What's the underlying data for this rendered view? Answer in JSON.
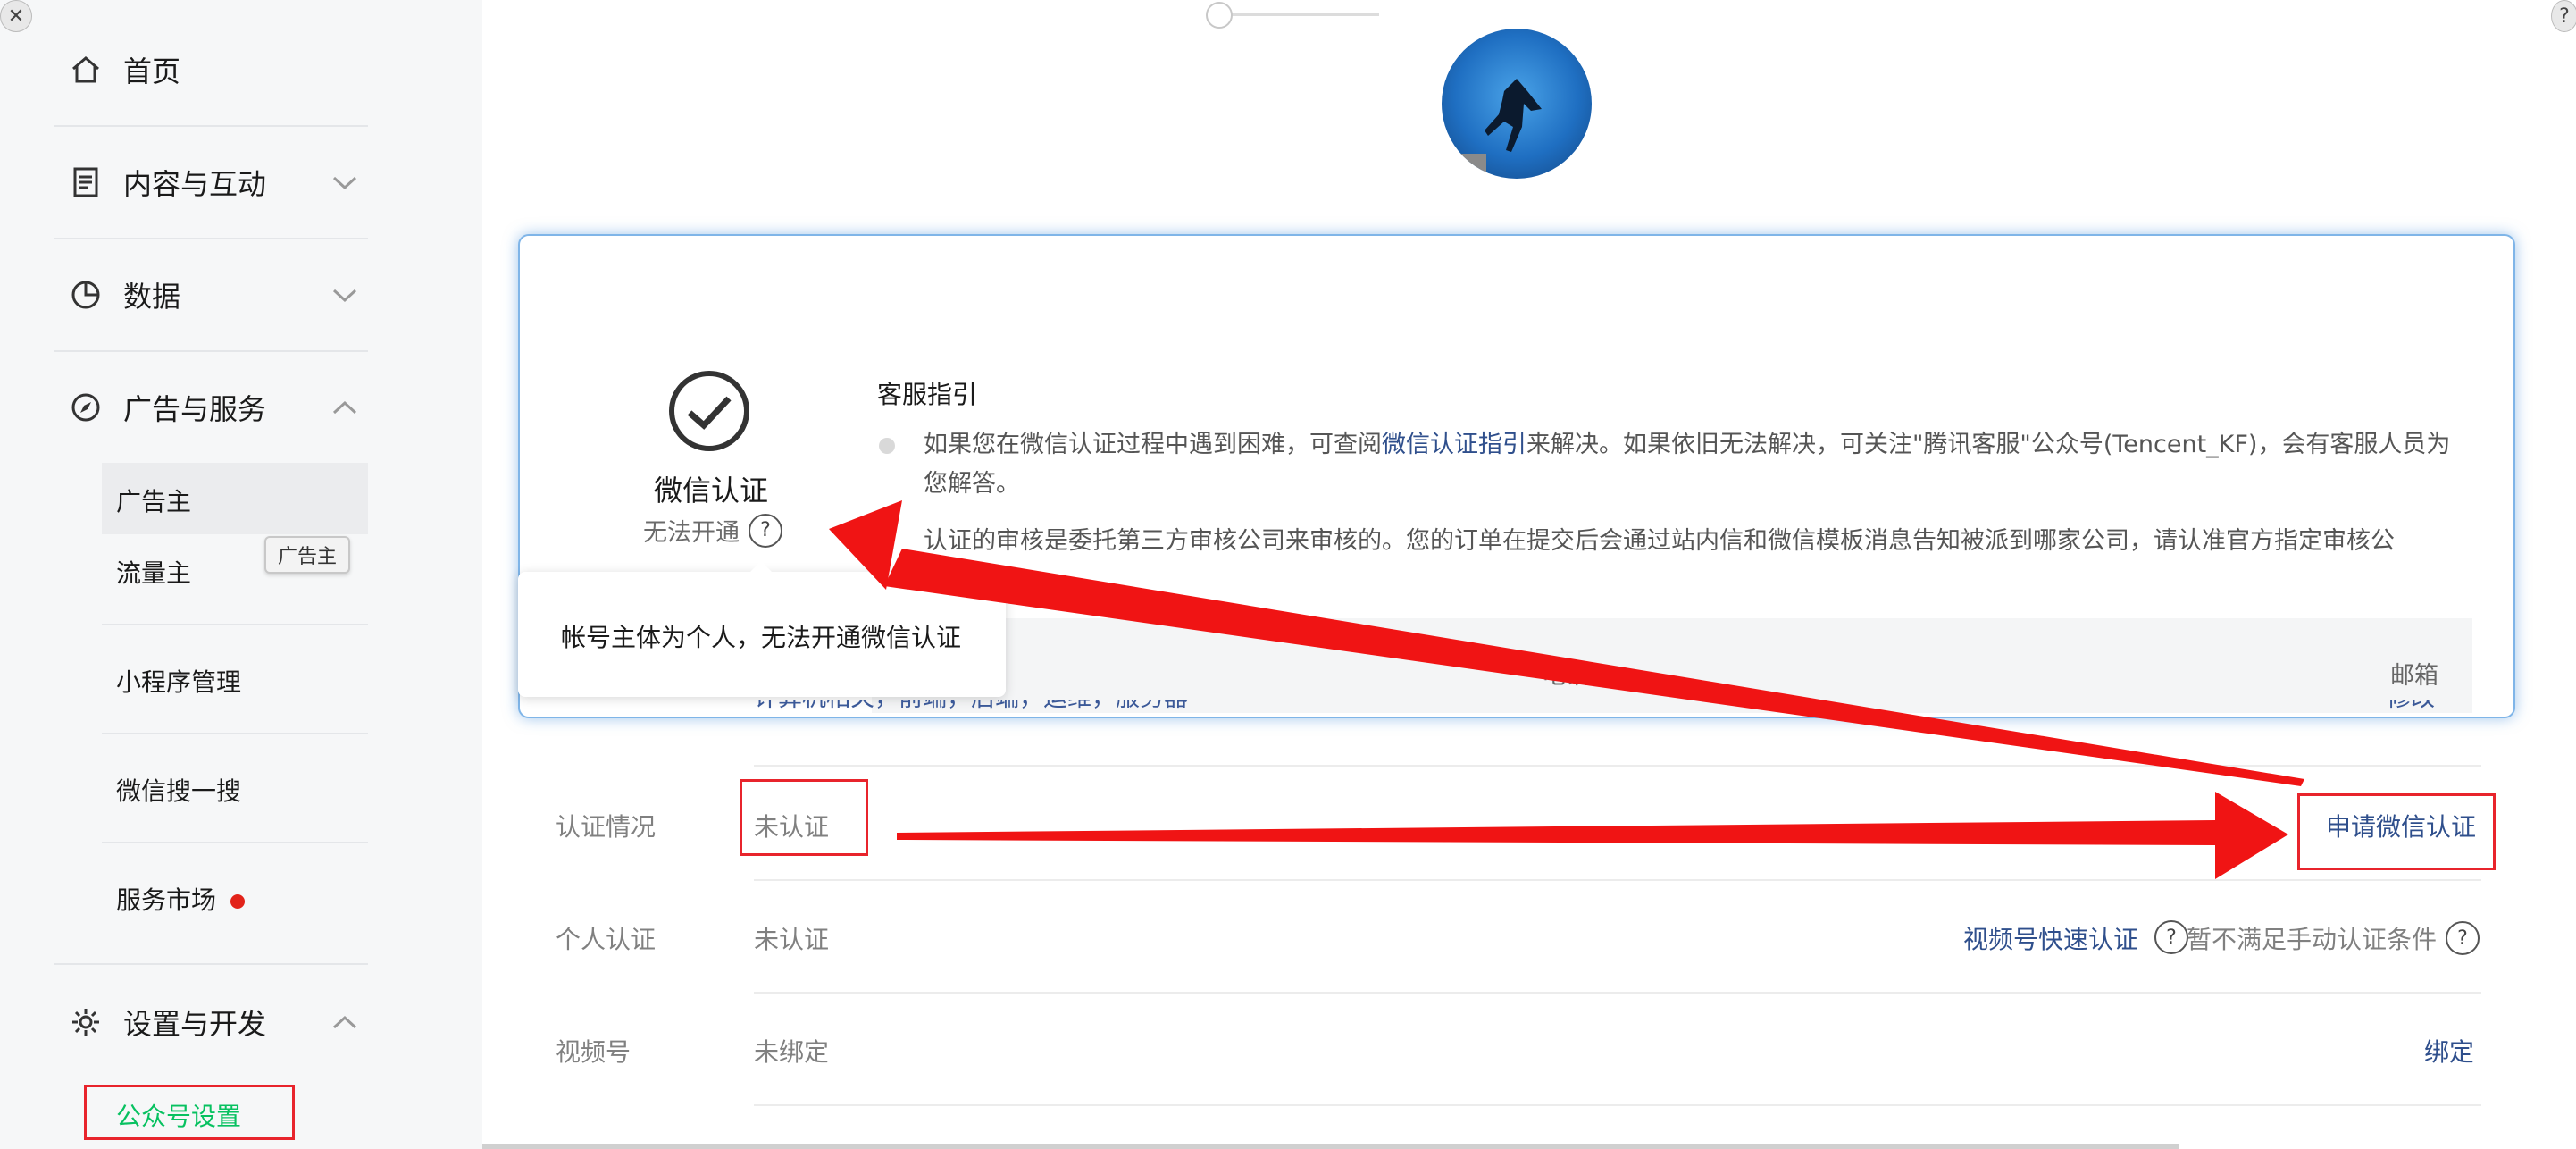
{
  "sidebar": {
    "home": "首页",
    "content": "内容与互动",
    "data": "数据",
    "ads": "广告与服务",
    "ads_sub": [
      "广告主",
      "流量主",
      "小程序管理",
      "微信搜一搜",
      "服务市场"
    ],
    "tooltip": "广告主",
    "settings": "设置与开发",
    "settings_sub": "公众号设置"
  },
  "dialog": {
    "title": "微信认证",
    "status": "无法开通",
    "help_mark": "?",
    "service_title": "客服指引",
    "bullet1_before": "如果您在微信认证过程中遇到困难，可查阅",
    "bullet1_link": "微信认证指引",
    "bullet1_after": "来解决。如果依旧无法解决，可关注\"腾讯客服\"公众号(Tencent_KF)，会有客服人员为",
    "bullet1_line2": "您解答。",
    "bullet2": "认证的审核是委托第三方审核公司来审核的。您的订单在提交后会通过站内信和微信模板消息告知被派到哪家公司，请认准官方指定审核公",
    "bar_phone": "电话",
    "bar_email": "邮箱",
    "popover": "帐号主体为个人，无法开通微信认证"
  },
  "rows": {
    "partial_value": "计算机相关，前端，后端，运维，服务器",
    "partial_action": "修改",
    "auth_label": "认证情况",
    "auth_value": "未认证",
    "auth_action": "申请微信认证",
    "personal_label": "个人认证",
    "personal_value": "未认证",
    "personal_action": "视频号快速认证",
    "personal_note": "暂不满足手动认证条件",
    "video_label": "视频号",
    "video_value": "未绑定",
    "video_action": "绑定"
  },
  "colors": {
    "annotation_red": "#e8242c",
    "link_blue": "#2f4f8c",
    "active_green": "#07c160"
  }
}
